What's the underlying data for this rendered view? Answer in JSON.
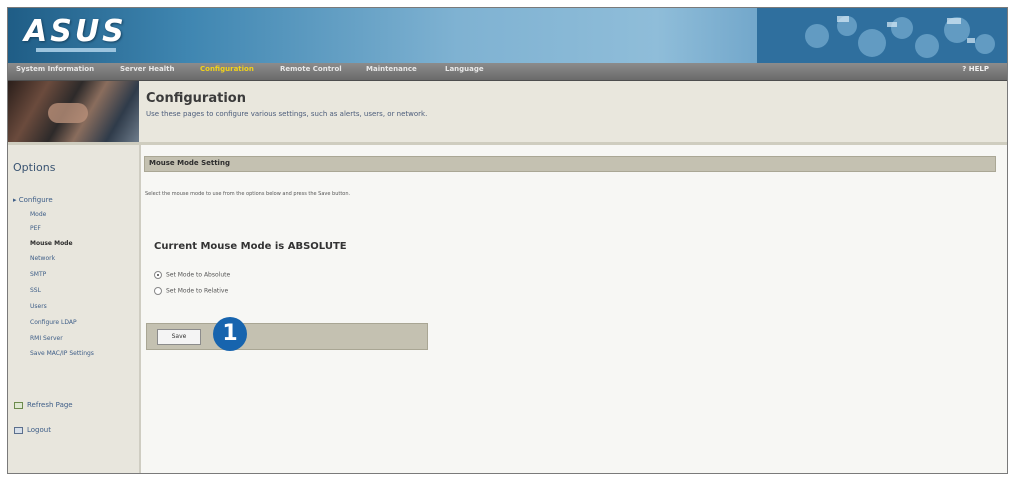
{
  "header": {
    "logo": "ASUS"
  },
  "nav": {
    "items": [
      {
        "label": "System Information",
        "active": false
      },
      {
        "label": "Server Health",
        "active": false
      },
      {
        "label": "Configuration",
        "active": true
      },
      {
        "label": "Remote Control",
        "active": false
      },
      {
        "label": "Maintenance",
        "active": false
      },
      {
        "label": "Language",
        "active": false
      }
    ],
    "help": "? HELP"
  },
  "banner": {
    "title": "Configuration",
    "description": "Use these pages to configure various settings, such as alerts, users, or network."
  },
  "sidebar": {
    "title": "Options",
    "configure_label": "Configure",
    "sub_items": [
      "Mode",
      "PEF",
      "Mouse Mode",
      "Network",
      "SMTP",
      "SSL",
      "Users",
      "Configure LDAP",
      "RMI Server",
      "Save MAC/IP Settings"
    ],
    "active_item": "Mouse Mode",
    "main_items": [
      {
        "label": "Refresh Page",
        "icon": "refresh-icon"
      },
      {
        "label": "Logout",
        "icon": "logout-icon"
      }
    ]
  },
  "main": {
    "section_title": "Mouse Mode Setting",
    "instruction": "Select the mouse mode to use from the options below and press the Save button.",
    "current_mode": "Current Mouse Mode is ABSOLUTE",
    "options": [
      {
        "label": "Set Mode to Absolute",
        "checked": true
      },
      {
        "label": "Set Mode to Relative",
        "checked": false
      }
    ],
    "save_label": "Save",
    "callout": "1"
  },
  "colors": {
    "header_blue": "#3f86b1",
    "nav_active": "#f1d21a",
    "callout_blue": "#1764ae",
    "section_bar": "#c4c1b1"
  }
}
